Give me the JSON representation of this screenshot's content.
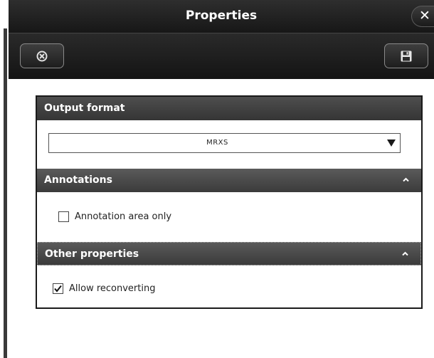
{
  "window": {
    "title": "Properties",
    "close_label": "✕"
  },
  "toolbar": {
    "reset_icon": "reset-icon",
    "save_icon": "floppy-disk-icon"
  },
  "sections": {
    "output_format": {
      "title": "Output format",
      "selected_value": "MRXS"
    },
    "annotations": {
      "title": "Annotations",
      "checkbox_label": "Annotation area only",
      "checked": false
    },
    "other_properties": {
      "title": "Other properties",
      "checkbox_label": "Allow reconverting",
      "checked": true
    }
  },
  "colors": {
    "titlebar": "#1e1e1e",
    "section_header": "#4a4a4a",
    "text_on_dark": "#ffffff"
  }
}
